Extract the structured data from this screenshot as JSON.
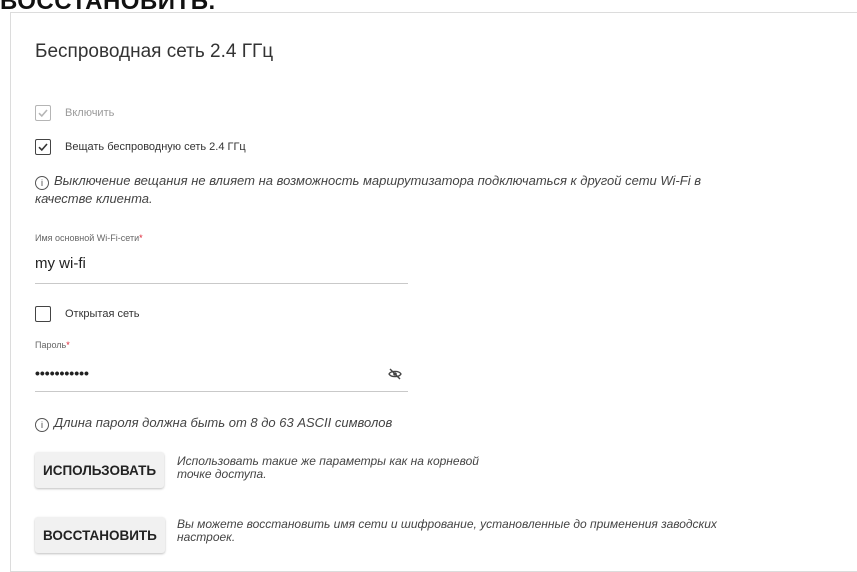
{
  "top_partial_text": "ВОССТАНОВИТЬ.",
  "section": {
    "title": "Беспроводная сеть 2.4 ГГц"
  },
  "checkboxes": {
    "enable": {
      "label": "Включить",
      "checked": true,
      "disabled": true
    },
    "broadcast": {
      "label": "Вещать беспроводную сеть 2.4 ГГц",
      "checked": true
    },
    "open_network": {
      "label": "Открытая сеть",
      "checked": false
    }
  },
  "notes": {
    "broadcast_info": "Выключение вещания не влияет на возможность маршрутизатора подключаться к другой сети Wi-Fi в",
    "broadcast_info_line2": "качестве клиента.",
    "password_info": "Длина пароля должна быть от 8 до 63 ASCII символов"
  },
  "ssid": {
    "label": "Имя основной Wi-Fi-сети",
    "required_mark": "*",
    "value": "my wi-fi"
  },
  "password": {
    "label": "Пароль",
    "required_mark": "*",
    "value": "•••••••••••"
  },
  "buttons": {
    "use": {
      "label": "ИСПОЛЬЗОВАТЬ",
      "desc_line1": "Использовать такие же параметры как на корневой",
      "desc_line2": "точке доступа."
    },
    "restore": {
      "label": "ВОССТАНОВИТЬ",
      "desc_line1": "Вы можете восстановить имя сети и шифрование, установленные до применения заводских",
      "desc_line2": "настроек."
    }
  },
  "icons": {
    "info": "info-circle-icon",
    "check": "checkmark-icon",
    "eye": "eye-off-icon"
  }
}
